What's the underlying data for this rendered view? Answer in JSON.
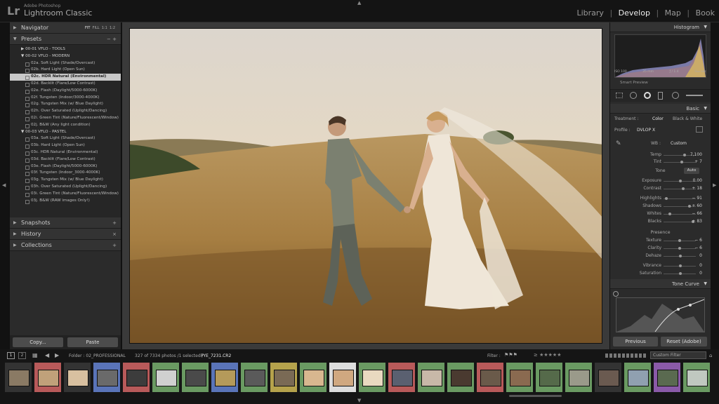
{
  "app": {
    "logo": "Lr",
    "brand_line1": "Adobe Photoshop",
    "brand_line2": "Lightroom Classic"
  },
  "modules": [
    "Library",
    "Develop",
    "Map",
    "Book"
  ],
  "active_module": "Develop",
  "left_panel": {
    "navigator": {
      "title": "Navigator",
      "zoom_options": [
        "FIT",
        "FILL",
        "1:1",
        "1:2"
      ]
    },
    "presets": {
      "title": "Presets",
      "groups": [
        {
          "name": "00-01 VFLO - TOOLS",
          "items": []
        },
        {
          "name": "00-02 VFLO - MODERN",
          "items": [
            "02a. Soft Light (Shade/Overcast)",
            "02b. Hard Light (Open Sun)",
            "02c. HDR Natural (Environmental)",
            "02d. Backlit (Flare/Low Contrast)",
            "02e. Flash (Daylight/5000-6000K)",
            "02f. Tungsten (Indoor/3000-4000K)",
            "02g. Tungsten Mix (w/ Blue Daylight)",
            "02h. Over Saturated (Uplight/Dancing)",
            "02i. Green Tint (Nature/Fluorescent/Window)",
            "02j. B&W (Any light condition)"
          ]
        },
        {
          "name": "00-03 VFLO - PASTEL",
          "items": [
            "03a. Soft Light (Shade/Overcast)",
            "03b. Hard Light (Open Sun)",
            "03c. HDR Natural (Environmental)",
            "03d. Backlit (Flare/Low Contrast)",
            "03e. Flash (Daylight/5000-6000K)",
            "03f. Tungsten (Indoor_3000-4000K)",
            "03g. Tungsten Mix (w/ Blue Daylight)",
            "03h. Over Saturated (Uplight/Dancing)",
            "03i. Green Tint (Nature/Fluorescent/Window)",
            "03j. B&W (RAW images Only!)"
          ]
        }
      ],
      "selected_item": "02c. HDR Natural (Environmental)"
    },
    "snapshots": "Snapshots",
    "history": "History",
    "collections": "Collections",
    "copy_button": "Copy...",
    "paste_button": "Paste"
  },
  "right_panel": {
    "histogram": {
      "title": "Histogram",
      "info": [
        "ISO 100",
        "35 mm",
        "ƒ / 1.4",
        "¹⁄₄₀₀ sec"
      ],
      "smart_preview": "Smart Preview"
    },
    "basic": {
      "title": "Basic",
      "treatment_label": "Treatment :",
      "treatment_options": [
        "Color",
        "Black & White"
      ],
      "profile_label": "Profile :",
      "profile_value": "DVLOP X",
      "wb_label": "WB :",
      "wb_value": "Custom",
      "temp": {
        "label": "Temp",
        "value": "7,100",
        "pos": 0.63
      },
      "tint": {
        "label": "Tint",
        "value": "+ 7",
        "pos": 0.55
      },
      "tone_label": "Tone",
      "auto_button": "Auto",
      "exposure": {
        "label": "Exposure",
        "value": "0.00",
        "pos": 0.5
      },
      "contrast": {
        "label": "Contrast",
        "value": "+ 18",
        "pos": 0.59
      },
      "highlights": {
        "label": "Highlights",
        "value": "− 91",
        "pos": 0.05
      },
      "shadows": {
        "label": "Shadows",
        "value": "+ 60",
        "pos": 0.8
      },
      "whites": {
        "label": "Whites",
        "value": "− 66",
        "pos": 0.17
      },
      "blacks": {
        "label": "Blacks",
        "value": "+ 83",
        "pos": 0.92
      },
      "presence_label": "Presence",
      "texture": {
        "label": "Texture",
        "value": "− 6",
        "pos": 0.47
      },
      "clarity": {
        "label": "Clarity",
        "value": "− 6",
        "pos": 0.47
      },
      "dehaze": {
        "label": "Dehaze",
        "value": "0",
        "pos": 0.5
      },
      "vibrance": {
        "label": "Vibrance",
        "value": "0",
        "pos": 0.5
      },
      "saturation": {
        "label": "Saturation",
        "value": "0",
        "pos": 0.5
      }
    },
    "tone_curve": {
      "title": "Tone Curve"
    },
    "previous_button": "Previous",
    "reset_button": "Reset (Adobe)"
  },
  "filmstrip": {
    "views": [
      "1",
      "2"
    ],
    "folder": "Folder : 02_PROFESSIONAL",
    "count": "327 of 7334 photos /1 selected /",
    "filename": "PYE_7231.CR2",
    "filter_label": "Filter :",
    "custom_filter": "Custom Filter"
  },
  "colors": {
    "accent": "#eeeeee",
    "panel": "#2b2b2b",
    "red_label": "#b85a5a",
    "blue_label": "#5a74b8",
    "green_label": "#6a9a62",
    "yellow_label": "#b5a24c",
    "purple_label": "#8a5aa8"
  }
}
